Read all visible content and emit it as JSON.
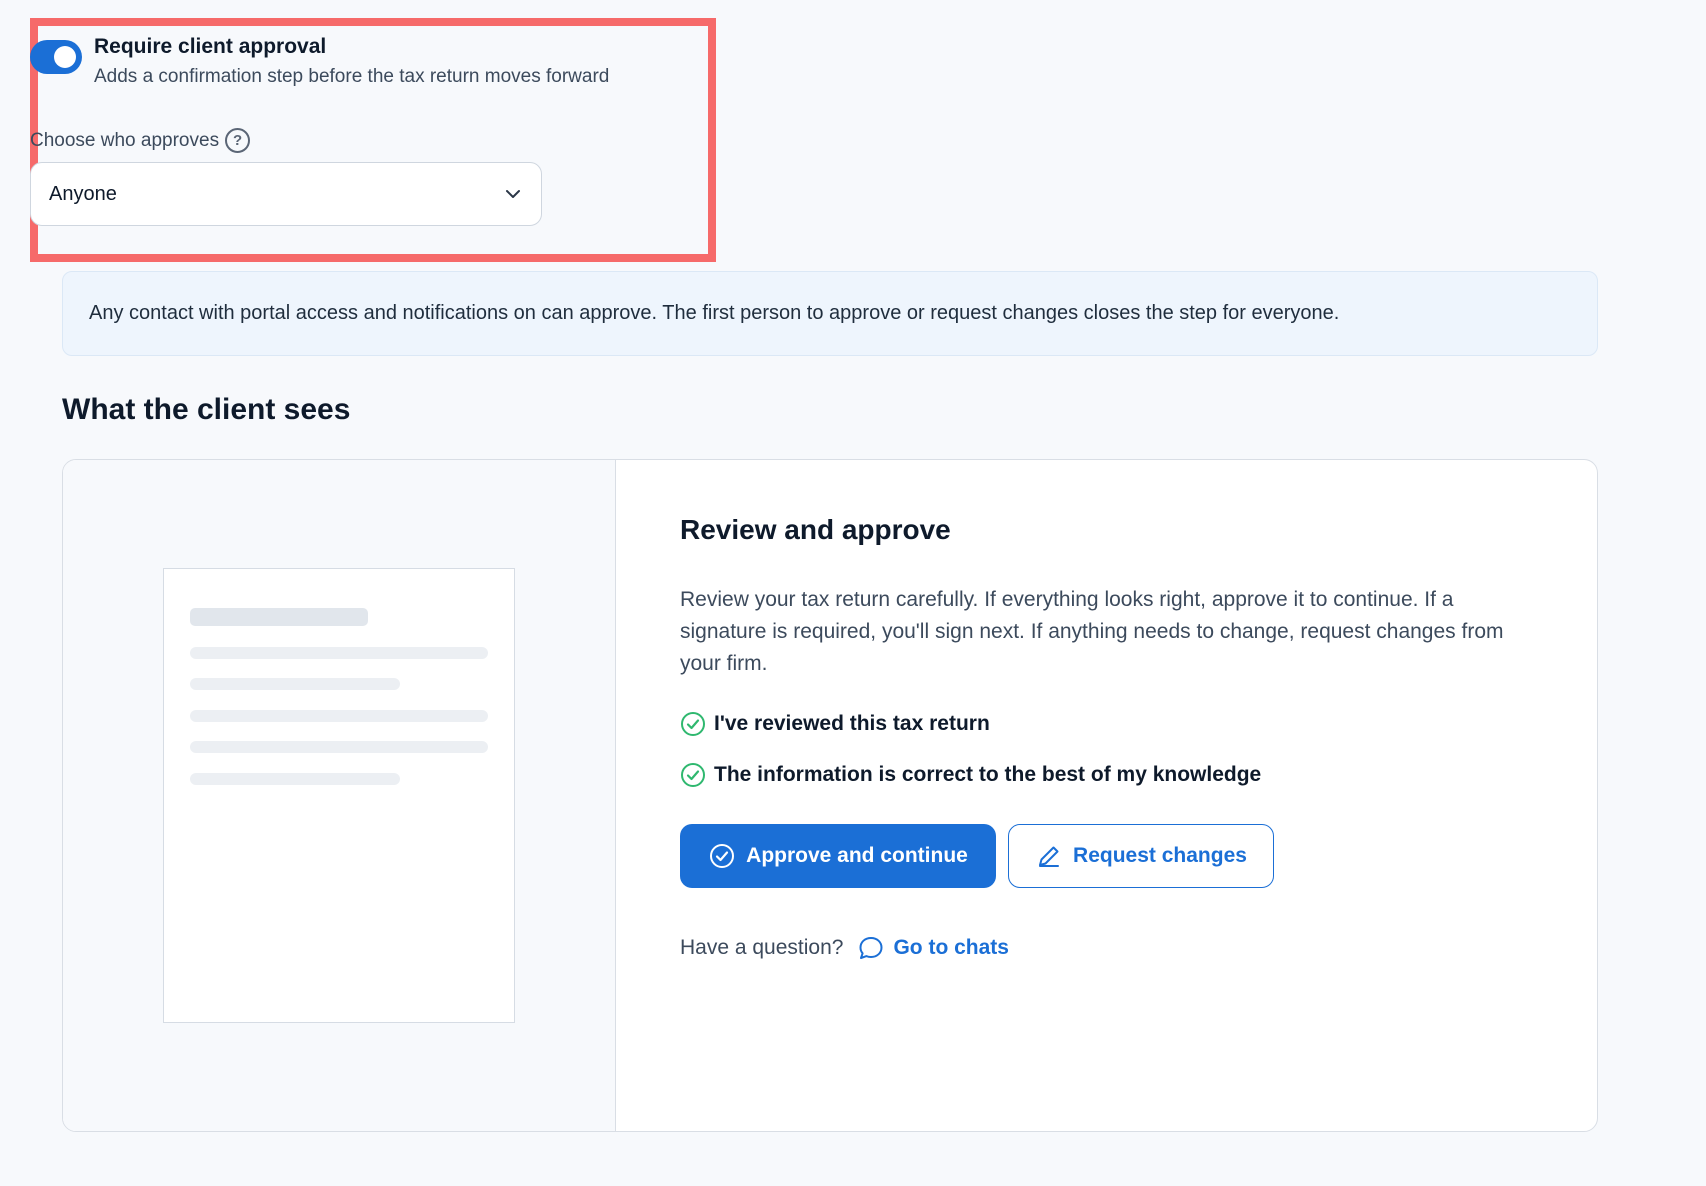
{
  "approval": {
    "toggle_on": true,
    "title": "Require client approval",
    "description": "Adds a confirmation step before the tax return moves forward",
    "approver_label": "Choose who approves",
    "help_glyph": "?",
    "approver_value": "Anyone"
  },
  "info": {
    "text": "Any contact with portal access and notifications on can approve. The first person to approve or request changes closes the step for everyone."
  },
  "preview": {
    "section_title": "What the client sees",
    "review_title": "Review and approve",
    "review_description": "Review your tax return carefully. If everything looks right, approve it to continue. If a signature is required, you'll sign next. If anything needs to change, request changes from your firm.",
    "checks": [
      "I've reviewed this tax return",
      "The information is correct to the best of my knowledge"
    ],
    "approve_label": "Approve and continue",
    "request_label": "Request changes",
    "question_text": "Have a question?",
    "chat_link": "Go to chats"
  },
  "colors": {
    "accent": "#1b6fd6",
    "check_green": "#2fb86f",
    "highlight": "#f66a6a"
  }
}
